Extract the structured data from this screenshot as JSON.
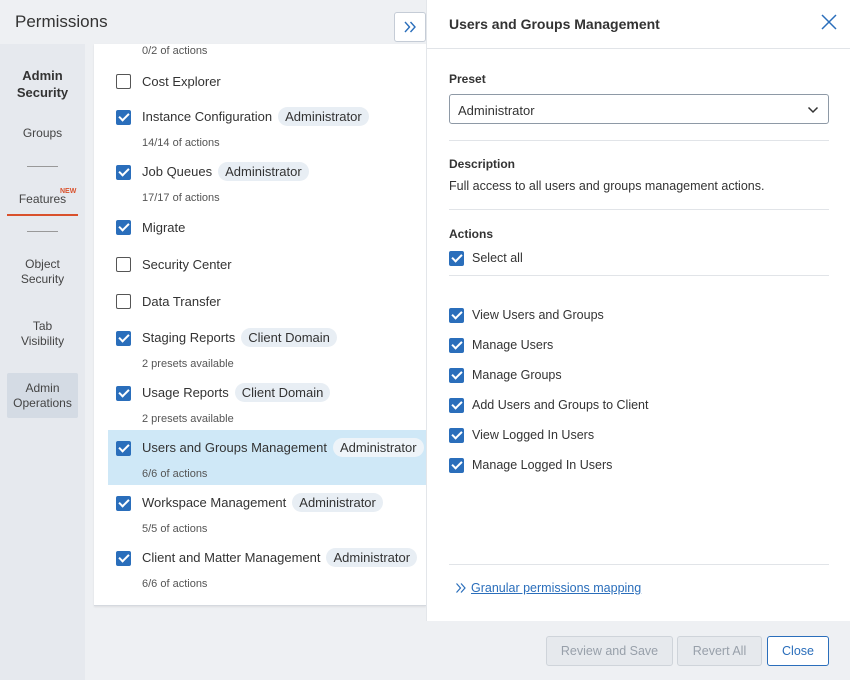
{
  "header": {
    "title": "Permissions"
  },
  "left_nav": {
    "heading_line1": "Admin",
    "heading_line2": "Security",
    "items": [
      {
        "label": "Groups"
      },
      {
        "label": "Features",
        "badge": "NEW"
      },
      {
        "label_line1": "Object",
        "label_line2": "Security"
      },
      {
        "label_line1": "Tab",
        "label_line2": "Visibility"
      },
      {
        "label_line1": "Admin",
        "label_line2": "Operations"
      }
    ]
  },
  "features": {
    "top_sub": "0/2 of actions",
    "rows": [
      {
        "label": "Cost Explorer",
        "checked": false,
        "pill": "",
        "sub": ""
      },
      {
        "label": "Instance Configuration",
        "checked": true,
        "pill": "Administrator",
        "sub": "14/14 of actions"
      },
      {
        "label": "Job Queues",
        "checked": true,
        "pill": "Administrator",
        "sub": "17/17 of actions"
      },
      {
        "label": "Migrate",
        "checked": true,
        "pill": "",
        "sub": ""
      },
      {
        "label": "Security Center",
        "checked": false,
        "pill": "",
        "sub": ""
      },
      {
        "label": "Data Transfer",
        "checked": false,
        "pill": "",
        "sub": ""
      },
      {
        "label": "Staging Reports",
        "checked": true,
        "pill": "Client Domain",
        "sub": "2 presets available"
      },
      {
        "label": "Usage Reports",
        "checked": true,
        "pill": "Client Domain",
        "sub": "2 presets available"
      },
      {
        "label": "Users and Groups Management",
        "checked": true,
        "pill": "Administrator",
        "sub": "6/6 of actions",
        "selected": true
      },
      {
        "label": "Workspace Management",
        "checked": true,
        "pill": "Administrator",
        "sub": "5/5 of actions"
      },
      {
        "label": "Client and Matter Management",
        "checked": true,
        "pill": "Administrator",
        "sub": "6/6 of actions"
      }
    ]
  },
  "detail": {
    "title": "Users and Groups Management",
    "preset_label": "Preset",
    "preset_value": "Administrator",
    "description_label": "Description",
    "description_text": "Full access to all users and groups management actions.",
    "actions_label": "Actions",
    "select_all_label": "Select all",
    "actions": [
      "View Users and Groups",
      "Manage Users",
      "Manage Groups",
      "Add Users and Groups to Client",
      "View Logged In Users",
      "Manage Logged In Users"
    ],
    "link_label": "Granular permissions mapping"
  },
  "footer": {
    "review_save": "Review and Save",
    "revert_all": "Revert All",
    "close": "Close"
  },
  "colors": {
    "accent": "#2a6ebb",
    "active_tab": "#d9512c",
    "selected_row": "#cfe8f7"
  },
  "icons": {
    "expand": "double-chevron-right-icon",
    "close": "close-icon",
    "dropdown": "chevron-down-icon",
    "link": "double-chevron-right-icon"
  }
}
